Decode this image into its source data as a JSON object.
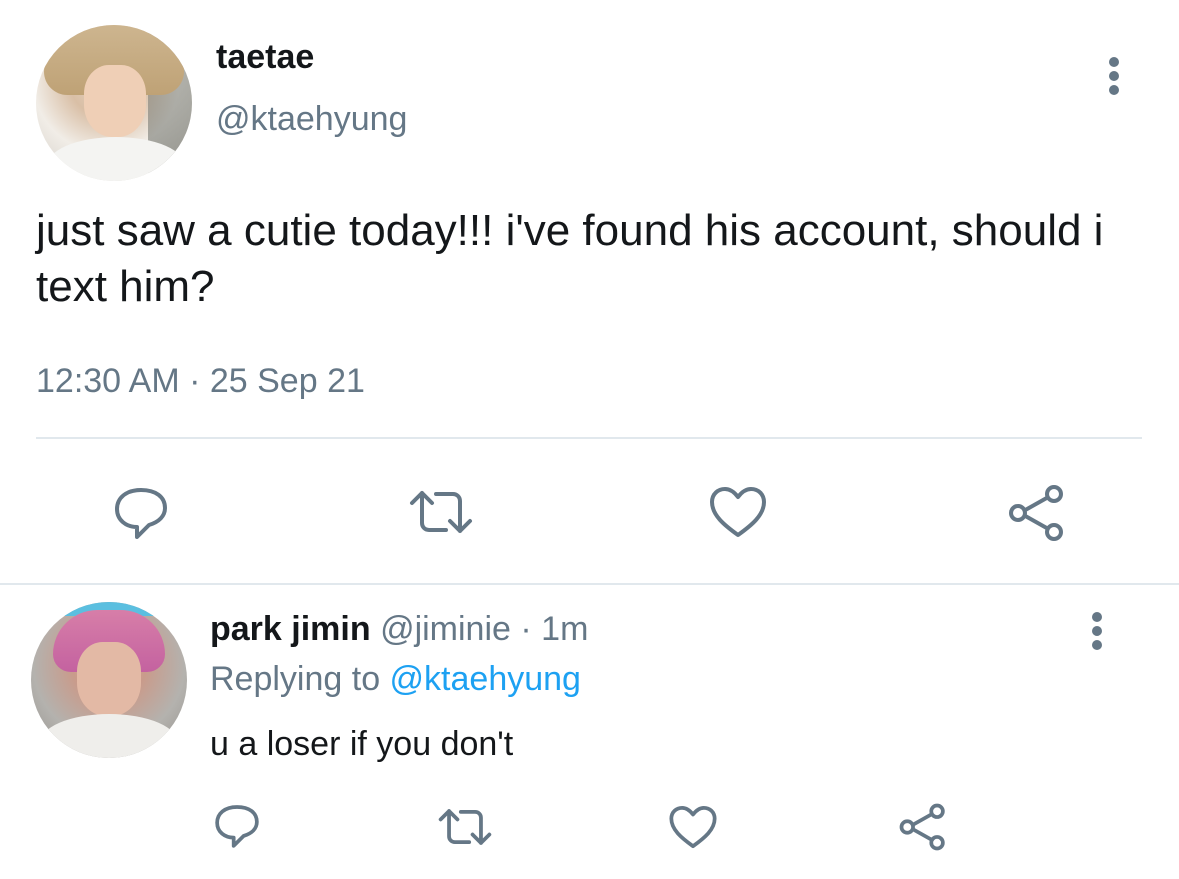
{
  "main_tweet": {
    "display_name": "taetae",
    "handle": "@ktaehyung",
    "text": "just saw a cutie today!!! i've found his account, should i text him?",
    "timestamp": "12:30 AM · 25 Sep 21",
    "actions": [
      "reply-icon",
      "retweet-icon",
      "like-icon",
      "share-icon"
    ]
  },
  "reply_tweet": {
    "display_name": "park jimin",
    "handle": "@jiminie",
    "separator": " · ",
    "time": "1m",
    "replying_prefix": "Replying to ",
    "replying_to": "@ktaehyung",
    "text": "u a loser if you don't",
    "actions": [
      "reply-icon",
      "retweet-icon",
      "like-icon",
      "share-icon"
    ]
  },
  "colors": {
    "text_primary": "#14171a",
    "text_secondary": "#657786",
    "link": "#1da1f2",
    "divider": "#e1e8ed"
  }
}
